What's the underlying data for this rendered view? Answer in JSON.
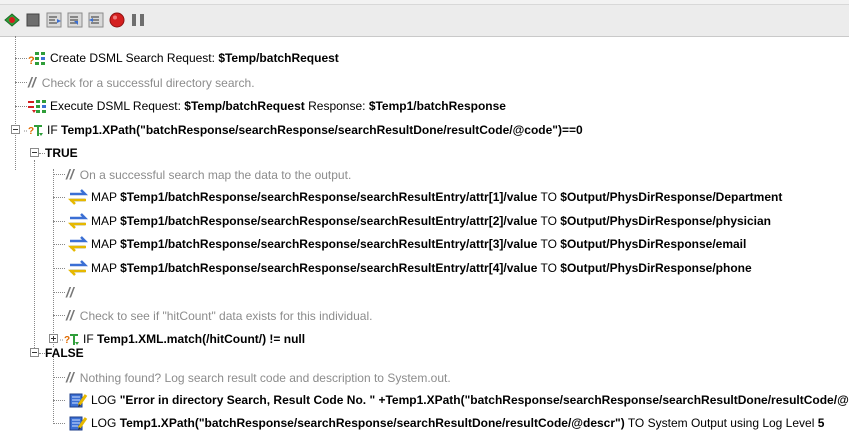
{
  "toolbar": {
    "buttons": [
      {
        "icon": "green-run-icon"
      },
      {
        "icon": "stop-square-icon"
      },
      {
        "icon": "step-over-icon"
      },
      {
        "icon": "step-into-icon"
      },
      {
        "icon": "step-out-icon"
      },
      {
        "icon": "record-icon"
      },
      {
        "icon": "pause-icon"
      }
    ]
  },
  "tree": {
    "create_request": {
      "prefix": "Create DSML Search Request: ",
      "value": "$Temp/batchRequest"
    },
    "comment_check": "Check for a successful directory search.",
    "execute_request": {
      "prefix": "Execute DSML Request: ",
      "request": "$Temp/batchRequest",
      "mid": " Response: ",
      "response": "$Temp1/batchResponse"
    },
    "if_main": {
      "keyword": "IF ",
      "condition": "Temp1.XPath(\"batchResponse/searchResponse/searchResultDone/resultCode/@code\")==0"
    },
    "true_label": "TRUE",
    "comment_map": "On a successful search map the data to the output.",
    "maps": [
      {
        "keyword": "MAP ",
        "source": "$Temp1/batchResponse/searchResponse/searchResultEntry/attr[1]/value",
        "to": " TO ",
        "target": "$Output/PhysDirResponse/Department"
      },
      {
        "keyword": "MAP ",
        "source": "$Temp1/batchResponse/searchResponse/searchResultEntry/attr[2]/value",
        "to": " TO ",
        "target": "$Output/PhysDirResponse/physician"
      },
      {
        "keyword": "MAP ",
        "source": "$Temp1/batchResponse/searchResponse/searchResultEntry/attr[3]/value",
        "to": " TO ",
        "target": "$Output/PhysDirResponse/email"
      },
      {
        "keyword": "MAP ",
        "source": "$Temp1/batchResponse/searchResponse/searchResultEntry/attr[4]/value",
        "to": " TO ",
        "target": "$Output/PhysDirResponse/phone"
      }
    ],
    "comment_empty": "",
    "comment_hitcount": "Check to see if \"hitCount\" data exists for this individual.",
    "if_hitcount": {
      "keyword": "IF ",
      "condition": "Temp1.XML.match(/hitCount/) != null"
    },
    "false_label": "FALSE",
    "comment_nothing": "Nothing found? Log search result code and description to System.out.",
    "log1": {
      "keyword": "LOG ",
      "message": "\"Error in directory Search, Result Code No. \" +Temp1.XPath(\"batchResponse/searchResponse/searchResultDone/resultCode/@"
    },
    "log2": {
      "keyword": "LOG ",
      "message": "Temp1.XPath(\"batchResponse/searchResponse/searchResultDone/resultCode/@descr\")",
      "mid": " TO System Output using Log Level ",
      "level": "5"
    },
    "comment_slash": "//"
  },
  "colors": {
    "comment": "#8c8c8c",
    "map_arrow_blue": "#3b6fd4",
    "map_arrow_yellow": "#e6b800",
    "record_red": "#d41f1f",
    "run_green": "#2f9e3a"
  }
}
